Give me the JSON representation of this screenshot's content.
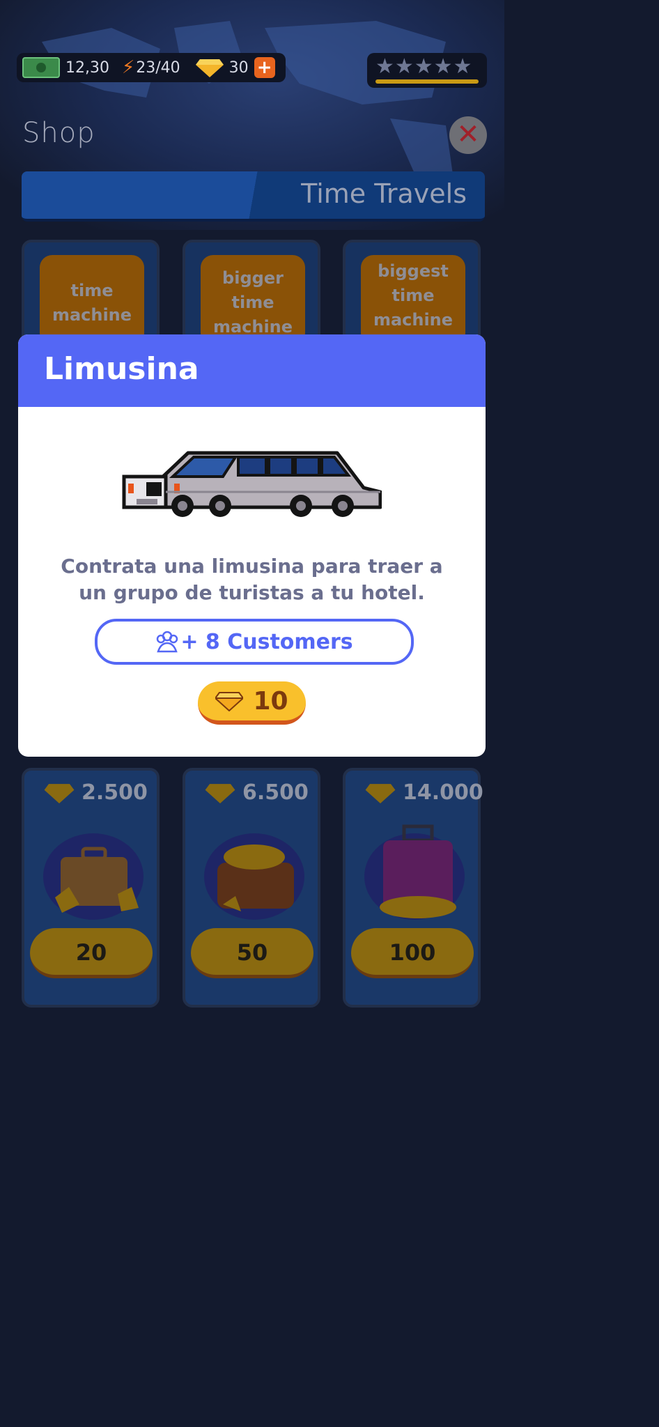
{
  "hud": {
    "cash": "12,30",
    "energy": "23/40",
    "gems": "30",
    "stars_filled": 5,
    "star_glyphs": "★★★★★"
  },
  "shop": {
    "title": "Shop",
    "close_icon": "✕",
    "section_tab": "Time Travels"
  },
  "time_items": [
    {
      "label": "time machine"
    },
    {
      "label": "bigger time machine"
    },
    {
      "label": "biggest time machine"
    }
  ],
  "gem_packs": [
    {
      "gems": "2.500",
      "price": "20",
      "art": "suitcase-with-gems"
    },
    {
      "gems": "6.500",
      "price": "50",
      "art": "bag-with-gems"
    },
    {
      "gems": "14.000",
      "price": "100",
      "art": "trolley-with-gems"
    }
  ],
  "modal": {
    "title": "Limusina",
    "description": "Contrata una limusina para traer a un grupo de turistas a tu hotel.",
    "customers_label": "+ 8 Customers",
    "cost": "10"
  },
  "colors": {
    "modal_header": "#5467f5",
    "cost_button": "#f9c02c",
    "background": "#131a2e"
  }
}
